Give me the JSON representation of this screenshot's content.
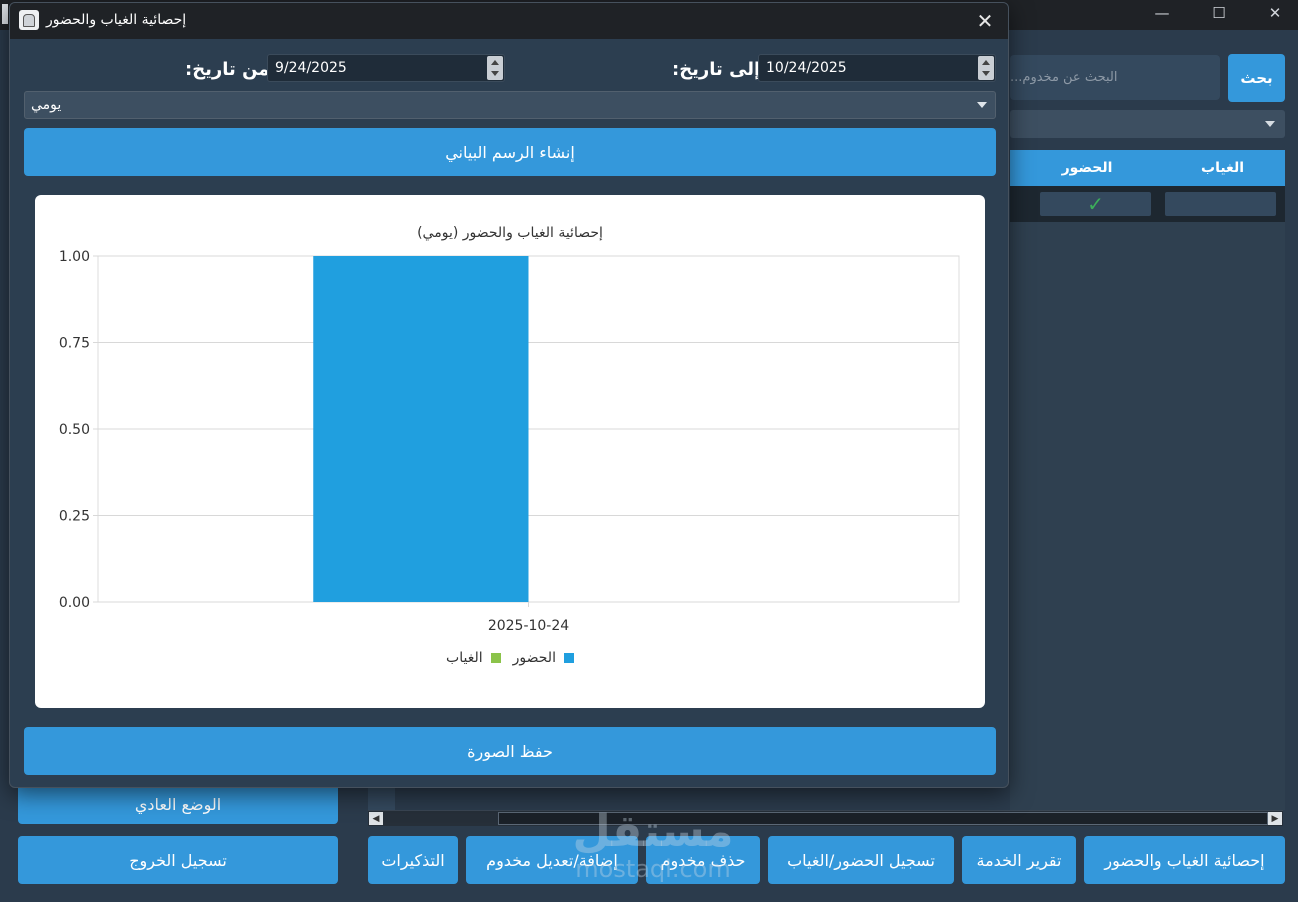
{
  "main_window": {
    "search": {
      "placeholder": "البحث عن مخدوم...",
      "button_label": "بحث"
    },
    "table": {
      "columns": [
        "الغياب",
        "الحضور"
      ],
      "rows": [
        {
          "absence": "",
          "attendance": "✓"
        }
      ]
    },
    "side_buttons": {
      "normal_mode": "الوضع العادي",
      "logout": "تسجيل الخروج"
    },
    "bottom_buttons": {
      "stats": "إحصائية الغياب والحضور",
      "service_report": "تقرير الخدمة",
      "record_attendance": "تسجيل الحضور/الغياب",
      "delete_member": "حذف مخدوم",
      "add_edit_member": "إضافة/تعديل مخدوم",
      "tickets": "التذكيرات"
    },
    "watermark": {
      "logo": "مستقل",
      "site": "mostaql.com"
    }
  },
  "dialog": {
    "title": "إحصائية الغياب والحضور",
    "close_glyph": "✕",
    "from_label": "من تاريخ:",
    "from_date": "9/24/2025",
    "to_label": "إلى تاريخ:",
    "to_date": "10/24/2025",
    "period": "يومي",
    "generate_label": "إنشاء الرسم البياني",
    "save_label": "حفظ الصورة"
  },
  "colors": {
    "accent": "#3498db",
    "attendance_series": "#209fdf",
    "absence_series": "#8bc34a",
    "check": "#3cae5a"
  },
  "chart_data": {
    "type": "bar",
    "title": "إحصائية الغياب والحضور (يومي)",
    "categories": [
      "2025-10-24"
    ],
    "series": [
      {
        "name": "الحضور",
        "values": [
          1.0
        ],
        "color": "#209fdf"
      },
      {
        "name": "الغياب",
        "values": [
          0.0
        ],
        "color": "#8bc34a"
      }
    ],
    "ylim": [
      0,
      1.0
    ],
    "yticks": [
      "0.00",
      "0.25",
      "0.50",
      "0.75",
      "1.00"
    ],
    "grid": true,
    "legend_position": "bottom"
  }
}
